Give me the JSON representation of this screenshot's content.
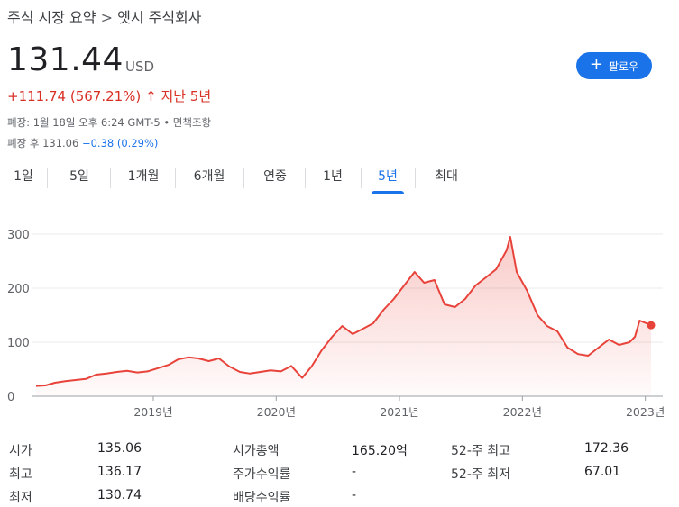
{
  "breadcrumb": {
    "root": "주식 시장 요약",
    "separator": ">",
    "company": "엣시 주식회사"
  },
  "quote": {
    "price": "131.44",
    "currency": "USD",
    "change": "+111.74",
    "change_pct": "(567.21%)",
    "change_arrow": "↑",
    "period": "지난 5년"
  },
  "follow_button": {
    "icon": "plus-icon",
    "label": "팔로우"
  },
  "meta": {
    "close_time": "폐장: 1월 18일 오후 6:24 GMT-5",
    "bullet": "•",
    "disclaimer": "면책조항",
    "after_hours_label": "폐장 후",
    "after_hours_price": "131.06",
    "after_hours_change": "−0.38 (0.29%)"
  },
  "tabs": [
    {
      "label": "1일",
      "active": false
    },
    {
      "label": "5일",
      "active": false
    },
    {
      "label": "1개월",
      "active": false
    },
    {
      "label": "6개월",
      "active": false
    },
    {
      "label": "연중",
      "active": false
    },
    {
      "label": "1년",
      "active": false
    },
    {
      "label": "5년",
      "active": true
    },
    {
      "label": "최대",
      "active": false
    }
  ],
  "colors": {
    "line": "#e8433a",
    "accent": "#1a73e8",
    "negative": "#d93025",
    "grid": "#ebebeb"
  },
  "chart_data": {
    "type": "area",
    "y_ticks": [
      "300",
      "200",
      "100",
      "0"
    ],
    "x_ticks": [
      "2019년",
      "2020년",
      "2021년",
      "2022년",
      "2023년"
    ],
    "ylim": [
      0,
      300
    ],
    "xlim": [
      "2018-01-18",
      "2023-01-18"
    ],
    "grid": true,
    "series": [
      {
        "x": [
          "2018-01-18",
          "2018-02-15",
          "2018-03-15",
          "2018-04-15",
          "2018-05-15",
          "2018-06-15",
          "2018-07-15",
          "2018-08-15",
          "2018-09-15",
          "2018-10-15",
          "2018-11-15",
          "2018-12-15",
          "2019-01-15",
          "2019-02-15",
          "2019-03-15",
          "2019-04-15",
          "2019-05-15",
          "2019-06-15",
          "2019-07-15",
          "2019-08-15",
          "2019-09-15",
          "2019-10-15",
          "2019-11-15",
          "2019-12-15",
          "2020-01-15",
          "2020-02-15",
          "2020-03-18",
          "2020-04-15",
          "2020-05-15",
          "2020-06-15",
          "2020-07-15",
          "2020-08-15",
          "2020-09-15",
          "2020-10-15",
          "2020-11-15",
          "2020-12-15",
          "2021-01-15",
          "2021-02-15",
          "2021-03-15",
          "2021-04-15",
          "2021-05-15",
          "2021-06-15",
          "2021-07-15",
          "2021-08-15",
          "2021-09-15",
          "2021-10-15",
          "2021-11-15",
          "2021-11-26",
          "2021-12-15",
          "2022-01-15",
          "2022-02-15",
          "2022-03-15",
          "2022-04-15",
          "2022-05-15",
          "2022-06-15",
          "2022-07-15",
          "2022-08-15",
          "2022-09-15",
          "2022-10-15",
          "2022-11-15",
          "2022-12-01",
          "2022-12-15",
          "2023-01-18"
        ],
        "y": [
          19,
          20,
          25,
          28,
          30,
          32,
          40,
          42,
          45,
          47,
          44,
          46,
          52,
          58,
          68,
          72,
          70,
          65,
          70,
          55,
          45,
          42,
          45,
          48,
          46,
          56,
          34,
          55,
          85,
          110,
          130,
          115,
          125,
          135,
          160,
          180,
          205,
          230,
          210,
          215,
          170,
          165,
          180,
          205,
          220,
          235,
          270,
          295,
          230,
          195,
          150,
          130,
          120,
          90,
          78,
          75,
          90,
          105,
          95,
          100,
          110,
          140,
          131.44
        ]
      }
    ]
  }
}
